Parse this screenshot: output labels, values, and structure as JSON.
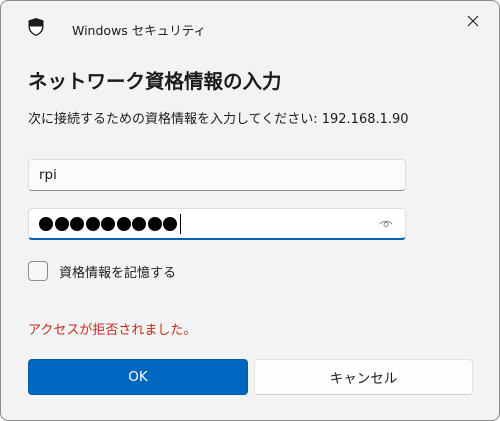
{
  "window": {
    "title": "Windows セキュリティ"
  },
  "dialog": {
    "heading": "ネットワーク資格情報の入力",
    "prompt": "次に接続するための資格情報を入力してください: 192.168.1.90",
    "username_value": "rpi",
    "password_dot_count": 9,
    "remember_label": "資格情報を記憶する",
    "remember_checked": false,
    "error_message": "アクセスが拒否されました。",
    "ok_label": "OK",
    "cancel_label": "キャンセル"
  },
  "icons": {
    "app": "shield-icon",
    "close": "close-icon",
    "reveal": "eye-icon"
  },
  "colors": {
    "accent": "#0067c0",
    "error": "#c42b1c",
    "focus_underline": "#005fb8"
  }
}
